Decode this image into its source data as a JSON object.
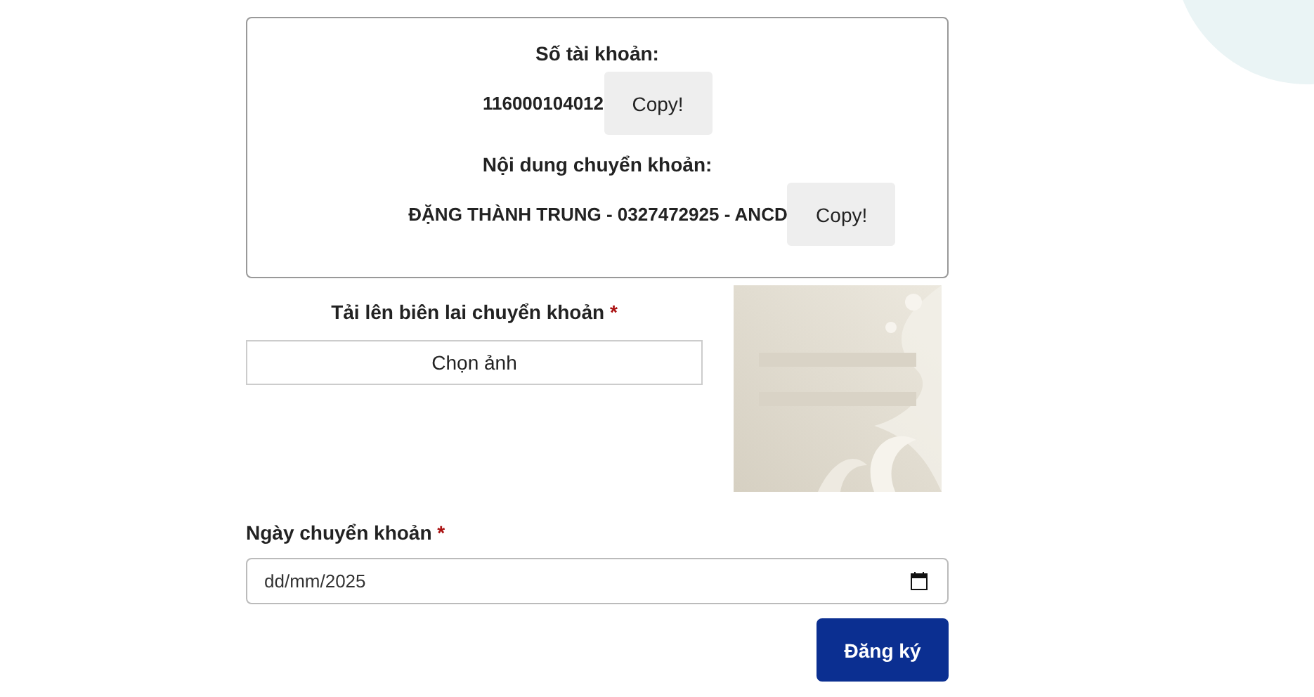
{
  "account": {
    "label": "Số tài khoản:",
    "number": "116000104012",
    "copy_button": "Copy!"
  },
  "transfer_note": {
    "label": "Nội dung chuyển khoản:",
    "content": "ĐẶNG THÀNH TRUNG - 0327472925 - ANCD",
    "copy_button": "Copy!"
  },
  "receipt_upload": {
    "label": "Tải lên biên lai chuyển khoản",
    "required_mark": "*",
    "button": "Chọn ảnh"
  },
  "transfer_date": {
    "label": "Ngày chuyển khoản",
    "required_mark": "*",
    "value": "dd/mm/2025"
  },
  "submit_button": "Đăng ký"
}
